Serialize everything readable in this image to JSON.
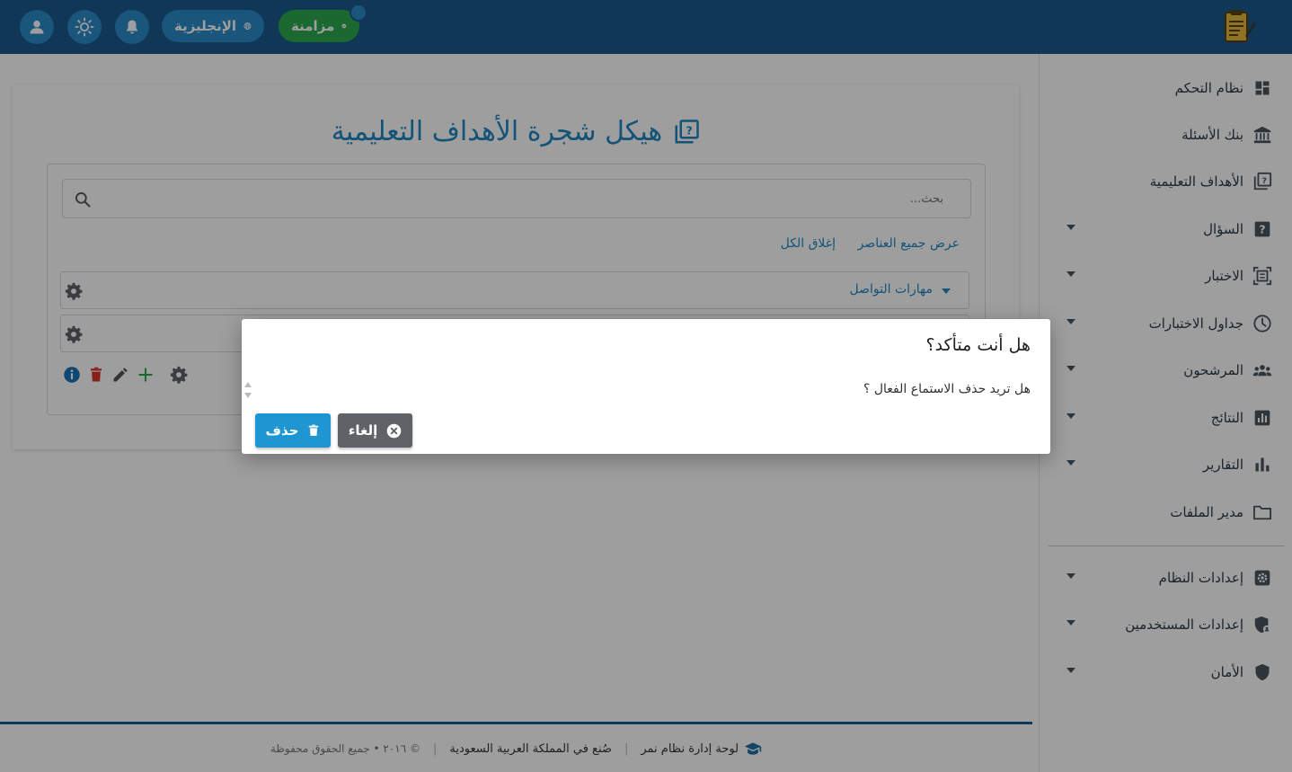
{
  "topbar": {
    "sync_label": "مزامنة",
    "language_label": "الإنجليزية",
    "colors": {
      "bar": "#1a5a8c",
      "button": "#2a8ac8",
      "sync": "#2ea84f"
    }
  },
  "sidebar": {
    "items": [
      {
        "label": "نظام التحكم",
        "icon": "dashboard-icon",
        "caret": false
      },
      {
        "label": "بنك الأسئلة",
        "icon": "bank-icon",
        "caret": false
      },
      {
        "label": "الأهداف التعليمية",
        "icon": "objectives-icon",
        "caret": false
      },
      {
        "label": "السؤال",
        "icon": "question-icon",
        "caret": true
      },
      {
        "label": "الاختبار",
        "icon": "exam-icon",
        "caret": true
      },
      {
        "label": "جداول الاختبارات",
        "icon": "clock-icon",
        "caret": true
      },
      {
        "label": "المرشحون",
        "icon": "people-icon",
        "caret": true
      },
      {
        "label": "النتائج",
        "icon": "results-icon",
        "caret": true
      },
      {
        "label": "التقارير",
        "icon": "reports-icon",
        "caret": true
      },
      {
        "label": "مدير الملفات",
        "icon": "folder-icon",
        "caret": false
      },
      {
        "label": "إعدادات النظام",
        "icon": "settings-icon",
        "caret": true
      },
      {
        "label": "إعدادات المستخدمين",
        "icon": "user-settings-icon",
        "caret": true
      },
      {
        "label": "الأمان",
        "icon": "shield-icon",
        "caret": true
      }
    ]
  },
  "main": {
    "title": "هيكل شجرة الأهداف التعليمية",
    "search_placeholder": "بحث...",
    "show_all": "عرض جميع العناصر",
    "close_all": "إغلاق الكل",
    "tree": [
      {
        "label": "مهارات التواصل"
      }
    ]
  },
  "modal": {
    "title": "هل أنت متأكد؟",
    "message": "هل تريد حذف الاستماع الفعال ؟",
    "delete_label": "حذف",
    "cancel_label": "إلغاء"
  },
  "footer": {
    "brand": "لوحة إدارة نظام نمر",
    "made_in": "صُنع في المملكة العربية السعودية",
    "copyright": "© ٢٠١٦ • جميع الحقوق محفوظة"
  }
}
